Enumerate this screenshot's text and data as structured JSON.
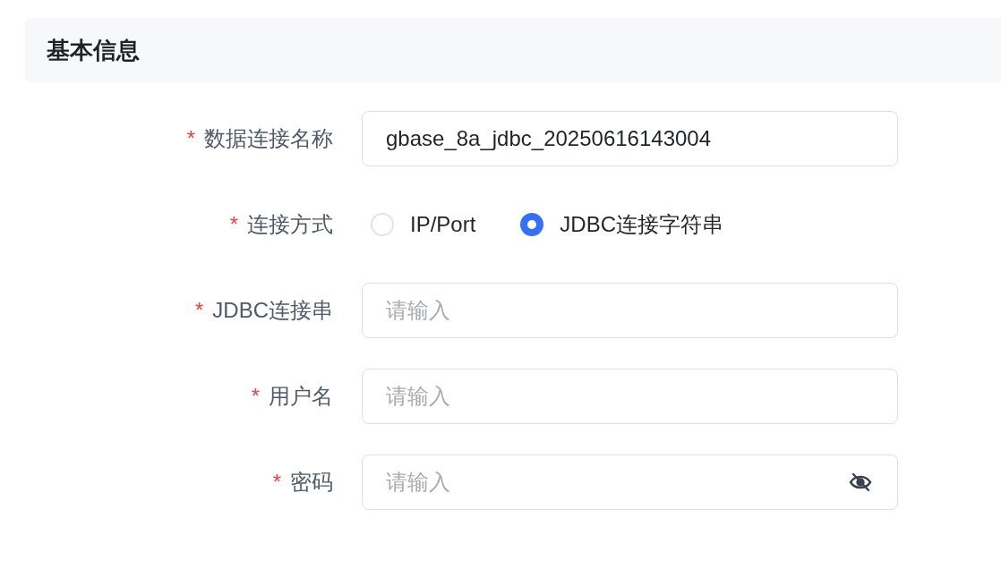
{
  "section": {
    "title": "基本信息"
  },
  "fields": [
    {
      "kind": "text",
      "required_mark": "*",
      "label": "数据连接名称",
      "value": "gbase_8a_jdbc_20250616143004"
    },
    {
      "kind": "radio",
      "required_mark": "*",
      "label": "连接方式",
      "options": [
        {
          "label": "IP/Port",
          "selected": false
        },
        {
          "label": "JDBC连接字符串",
          "selected": true
        }
      ]
    },
    {
      "kind": "text",
      "required_mark": "*",
      "label": "JDBC连接串",
      "placeholder": "请输入"
    },
    {
      "kind": "text",
      "required_mark": "*",
      "label": "用户名",
      "placeholder": "请输入"
    },
    {
      "kind": "password",
      "required_mark": "*",
      "label": "密码",
      "placeholder": "请输入"
    }
  ]
}
